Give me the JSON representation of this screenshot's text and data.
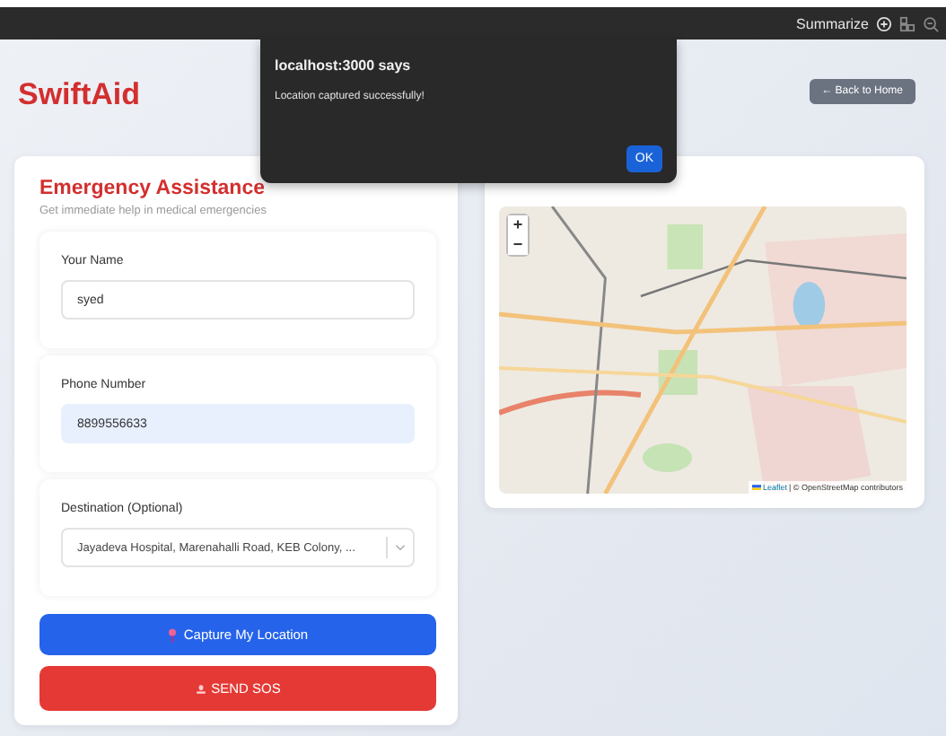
{
  "browser_bar": {
    "summarize_label": "Summarize"
  },
  "header": {
    "logo": "SwiftAid",
    "back_button": "← Back to Home"
  },
  "form": {
    "title": "Emergency Assistance",
    "subtitle": "Get immediate help in medical emergencies",
    "fields": [
      {
        "kind": "text",
        "label": "Your Name",
        "value": "syed",
        "autofilled": false
      },
      {
        "kind": "text",
        "label": "Phone Number",
        "value": "8899556633",
        "autofilled": true
      },
      {
        "kind": "select",
        "label": "Destination (Optional)",
        "value": "Jayadeva Hospital, Marenahalli Road, KEB Colony, ..."
      }
    ],
    "buttons": [
      {
        "kind": "location",
        "label": "Capture My Location"
      },
      {
        "kind": "sos",
        "label": "SEND SOS"
      }
    ]
  },
  "map": {
    "zoom_in": "+",
    "zoom_out": "−",
    "attribution_leaflet": "Leaflet",
    "attribution_rest": "| © OpenStreetMap contributors"
  },
  "dialog": {
    "title": "localhost:3000 says",
    "message": "Location captured successfully!",
    "button": "OK"
  }
}
